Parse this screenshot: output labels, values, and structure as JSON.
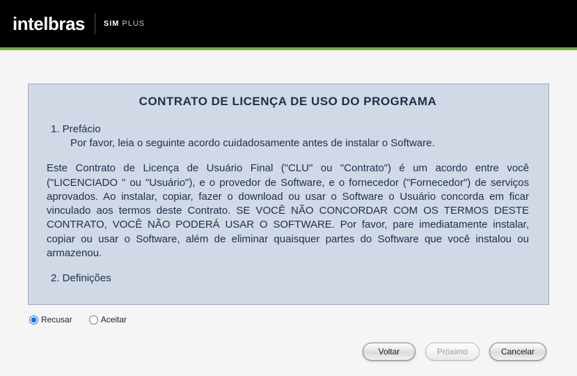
{
  "header": {
    "brand": "intelbras",
    "product_sim": "SIM",
    "product_plus": "PLUS"
  },
  "license": {
    "title": "CONTRATO DE LICENÇA DE USO DO PROGRAMA",
    "section1_heading": "1. Prefácio",
    "section1_text": "Por favor, leia o seguinte acordo cuidadosamente antes de instalar o Software.",
    "body_paragraph": "Este Contrato de Licença de Usuário Final (\"CLU\" ou \"Contrato\") é um acordo entre você (\"LICENCIADO \" ou \"Usuário\"), e o provedor de Software, e o fornecedor (\"Fornecedor\") de serviços aprovados. Ao instalar, copiar, fazer o download ou usar o Software o Usuário concorda em ficar vinculado aos termos deste Contrato. SE VOCÊ NÃO CONCORDAR COM OS TERMOS DESTE CONTRATO, VOCÊ NÃO PODERÁ USAR O SOFTWARE. Por favor, pare imediatamente instalar, copiar ou usar o Software, além de eliminar quaisquer partes do Software que você instalou ou armazenou.",
    "section2_heading": "2. Definições"
  },
  "radios": {
    "refuse": "Recusar",
    "accept": "Aceitar",
    "selected": "refuse"
  },
  "buttons": {
    "back": "Voltar",
    "next": "Próximo",
    "cancel": "Cancelar",
    "next_enabled": false
  }
}
